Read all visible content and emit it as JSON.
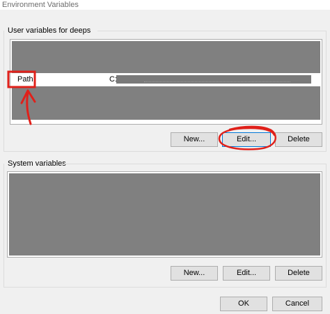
{
  "window": {
    "title": "Environment Variables"
  },
  "user_section": {
    "label": "User variables for deeps",
    "selected_row": {
      "name": "Path",
      "value_prefix": "C:"
    },
    "buttons": {
      "new": "New...",
      "edit": "Edit...",
      "delete": "Delete"
    }
  },
  "system_section": {
    "label": "System variables",
    "buttons": {
      "new": "New...",
      "edit": "Edit...",
      "delete": "Delete"
    }
  },
  "dialog_buttons": {
    "ok": "OK",
    "cancel": "Cancel"
  },
  "colors": {
    "redaction": "#808080",
    "annotation": "#e0201a",
    "dialog_bg": "#f0f0f0"
  }
}
